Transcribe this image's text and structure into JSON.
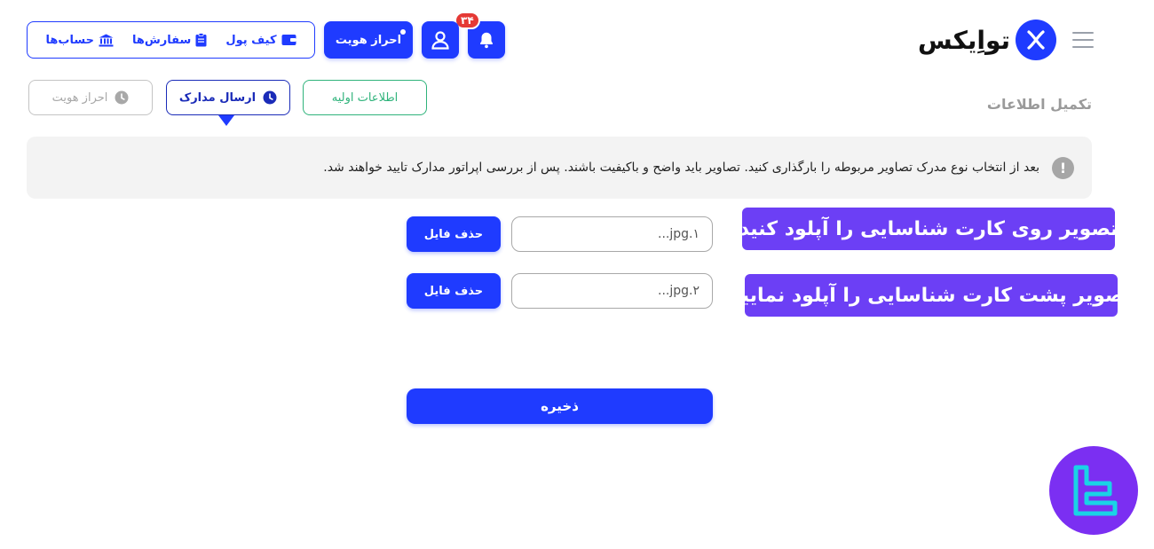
{
  "header": {
    "brand_name": "تواِیکس",
    "notification_count": "۳۴",
    "kyc_label": "احراز هویت",
    "nav": [
      {
        "label": "کیف پول",
        "icon": "wallet-icon"
      },
      {
        "label": "سفارش‌ها",
        "icon": "clipboard-icon"
      },
      {
        "label": "حساب‌ها",
        "icon": "bank-icon"
      }
    ]
  },
  "page": {
    "section_title": "تکمیل اطلاعات",
    "steps": [
      {
        "label": "اطلاعات اولیه",
        "state": "done"
      },
      {
        "label": "ارسال مدارک",
        "state": "active"
      },
      {
        "label": "احراز هویت",
        "state": "pending"
      }
    ],
    "notice": "بعد از انتخاب نوع مدرک تصاویر مربوطه را بارگذاری کنید. تصاویر باید واضح و باکیفیت باشند. پس از بررسی اپراتور مدارک تایید خواهند شد.",
    "uploads": [
      {
        "tag": "تصویر روی کارت شناسایی را آپلود کنید",
        "file_value": "jpg.۱...",
        "delete_label": "حذف فایل"
      },
      {
        "tag": "تصویر پشت کارت شناسایی را آپلود نمایید",
        "file_value": "jpg.۲...",
        "delete_label": "حذف فایل"
      }
    ],
    "save_label": "ذخیره"
  },
  "colors": {
    "primary": "#1f3bff",
    "success": "#2fb37b",
    "tag": "#6c3ff5",
    "badge": "#e53935",
    "watermark": "#7b2ff2"
  }
}
